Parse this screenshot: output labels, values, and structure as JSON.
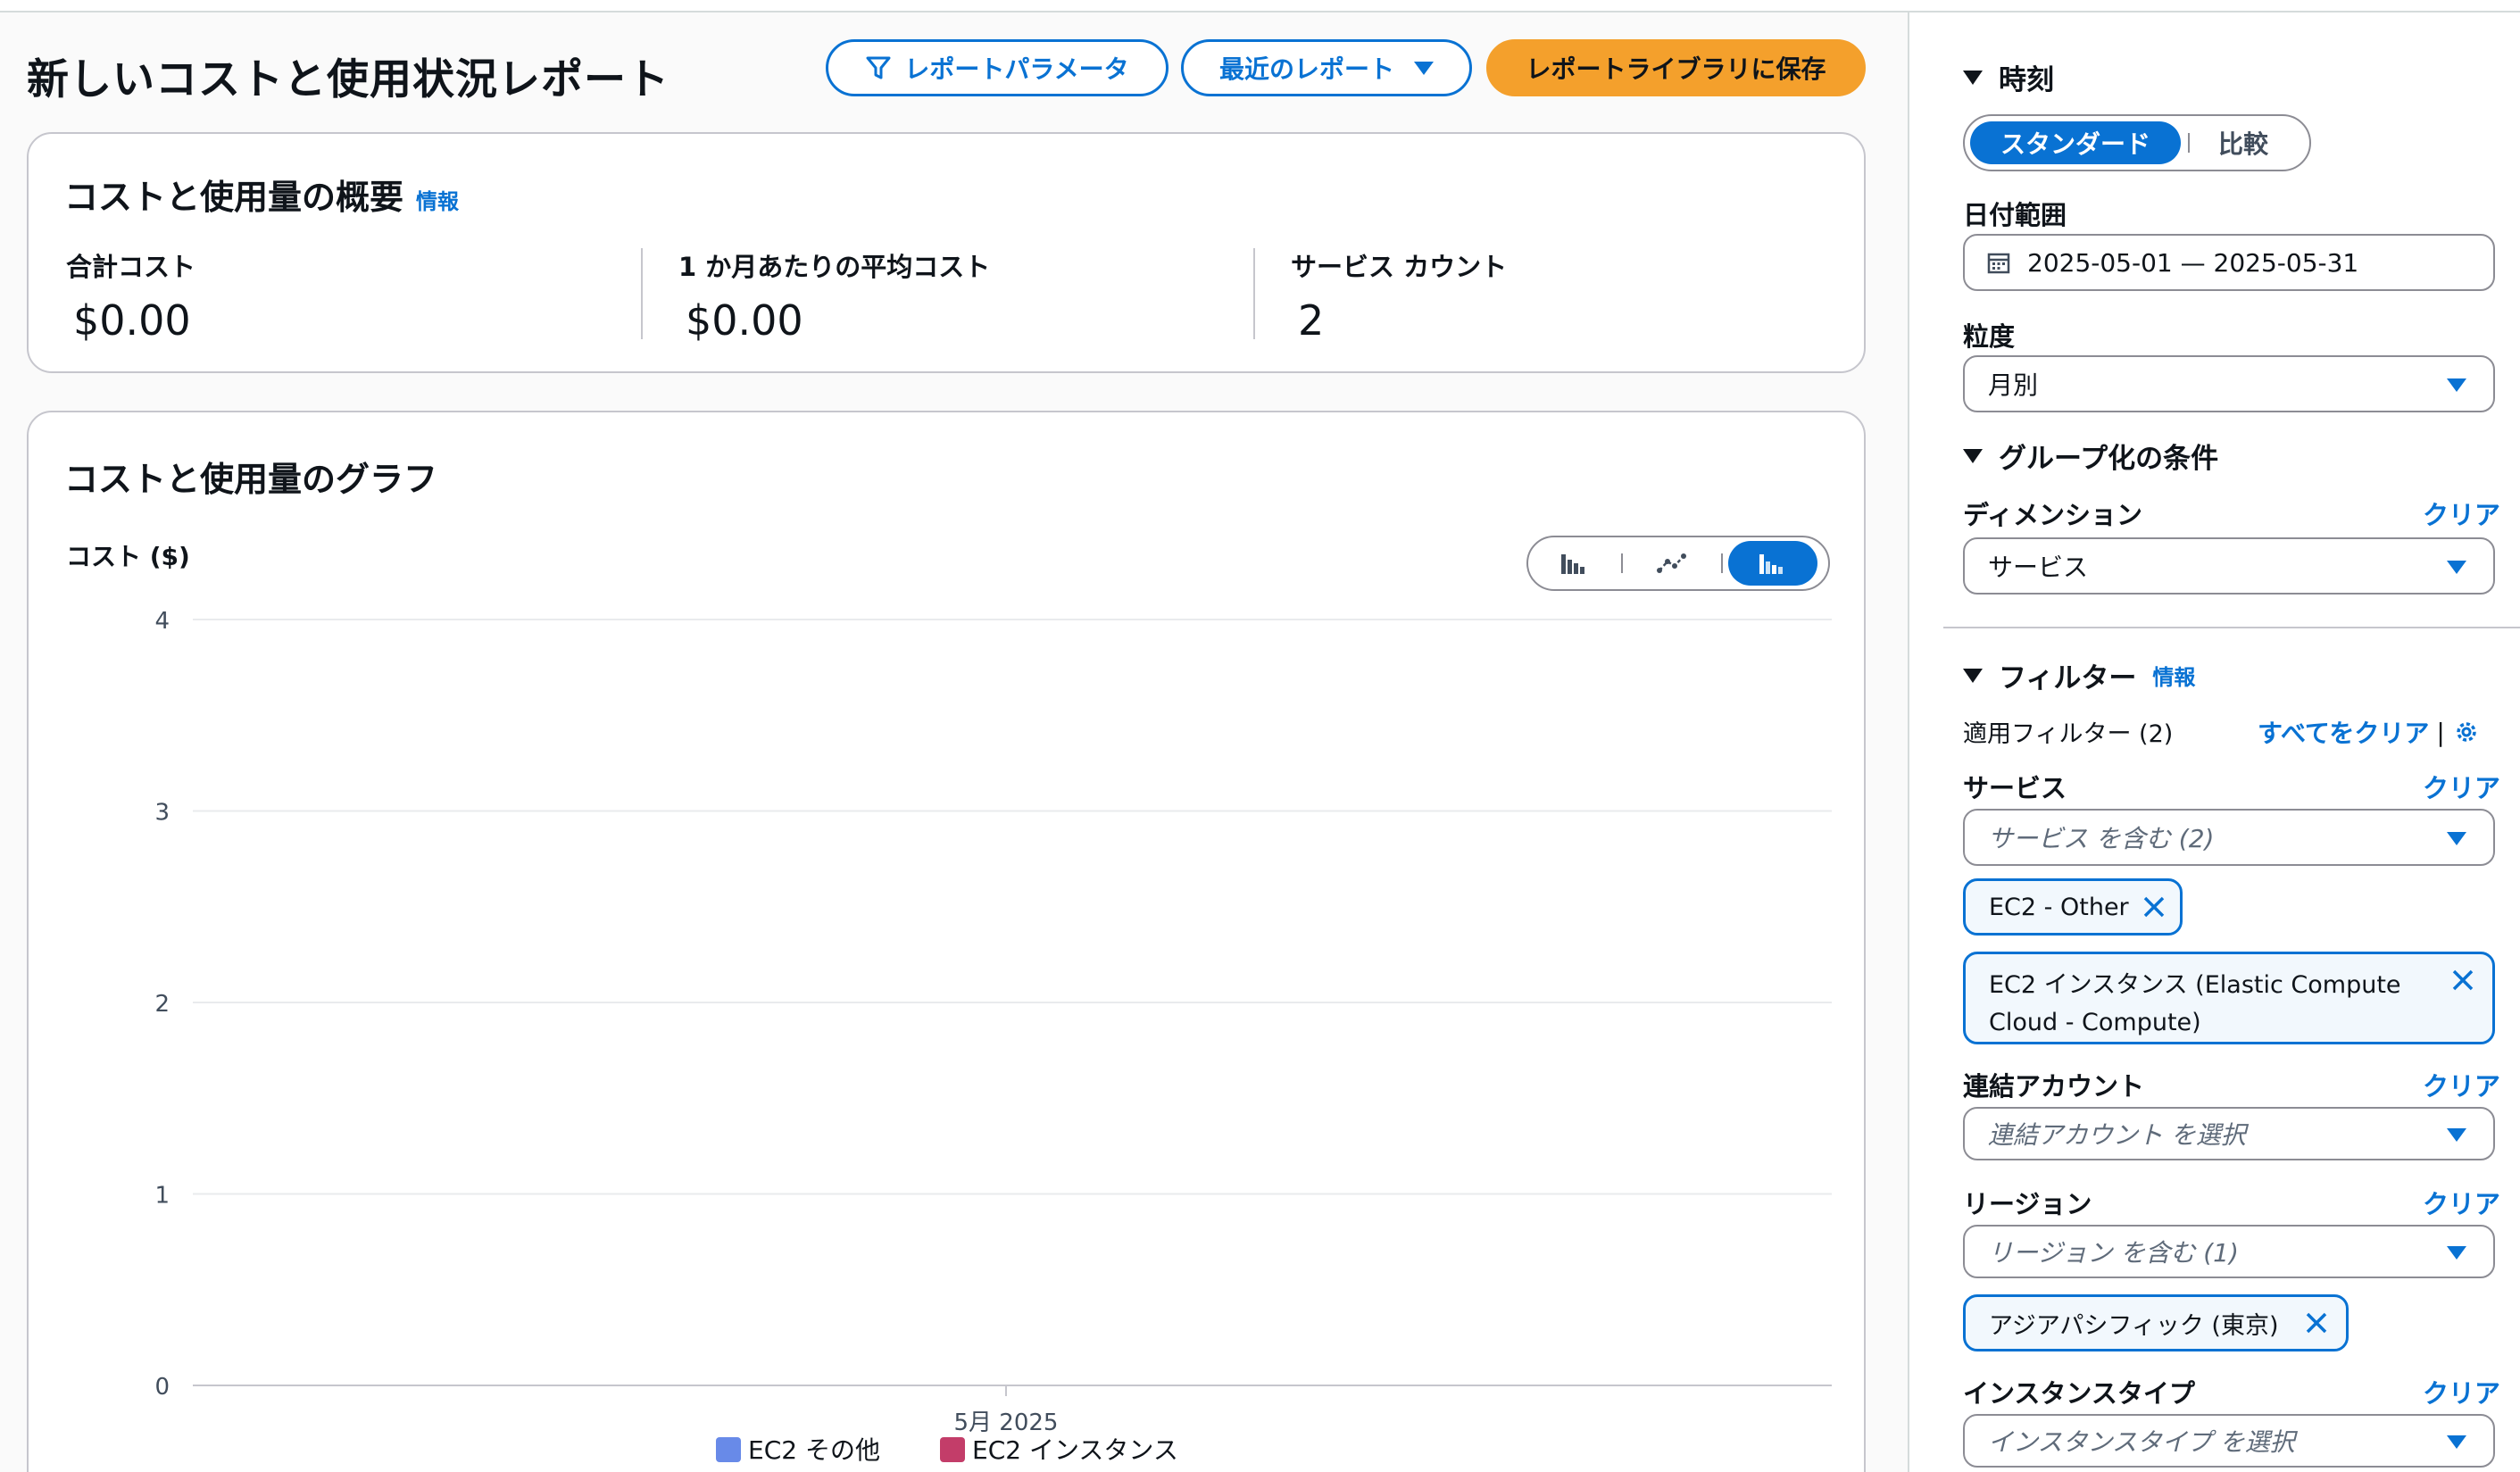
{
  "header": {
    "title": "新しいコストと使用状況レポート",
    "btn_params": "レポートパラメータ",
    "btn_recent": "最近のレポート",
    "btn_save": "レポートライブラリに保存"
  },
  "summary": {
    "title": "コストと使用量の概要",
    "info": "情報",
    "metrics": [
      {
        "label": "合計コスト",
        "value": "$0.00"
      },
      {
        "label": "1 か月あたりの平均コスト",
        "value": "$0.00"
      },
      {
        "label": "サービス カウント",
        "value": "2"
      }
    ]
  },
  "graph": {
    "title": "コストと使用量のグラフ",
    "ylabel": "コスト ($)"
  },
  "chart_data": {
    "type": "bar",
    "stacked": true,
    "title": "コストと使用量のグラフ",
    "ylabel": "コスト ($)",
    "xlabel": "",
    "categories": [
      "5月 2025"
    ],
    "series": [
      {
        "name": "EC2 その他",
        "color": "#688ae8",
        "values": [
          0
        ]
      },
      {
        "name": "EC2 インスタンス",
        "color": "#c33d69",
        "values": [
          0
        ]
      }
    ],
    "ylim": [
      0,
      4
    ],
    "yticks": [
      "0",
      "1",
      "2",
      "3",
      "4"
    ],
    "grid": true,
    "legend_position": "bottom"
  },
  "sidebar": {
    "time_header": "時刻",
    "mode_standard": "スタンダード",
    "mode_compare": "比較",
    "date_range_label": "日付範囲",
    "date_range_value": "2025-05-01 — 2025-05-31",
    "granularity_label": "粒度",
    "granularity_value": "月別",
    "group_header": "グループ化の条件",
    "dimension_label": "ディメンション",
    "dimension_clear": "クリア",
    "dimension_value": "サービス",
    "filter_header": "フィルター",
    "filter_info": "情報",
    "applied_filters": "適用フィルター (2)",
    "clear_all": "すべてをクリア",
    "service_label": "サービス",
    "service_clear": "クリア",
    "service_select": "サービス を含む (2)",
    "service_tokens": [
      "EC2 - Other",
      "EC2 インスタンス (Elastic Compute Cloud - Compute)"
    ],
    "account_label": "連結アカウント",
    "account_clear": "クリア",
    "account_placeholder": "連結アカウント を選択",
    "region_label": "リージョン",
    "region_clear": "クリア",
    "region_select": "リージョン を含む (1)",
    "region_token": "アジアパシフィック (東京)",
    "instance_label": "インスタンスタイプ",
    "instance_clear": "クリア",
    "instance_placeholder": "インスタンスタイプ を選択"
  }
}
